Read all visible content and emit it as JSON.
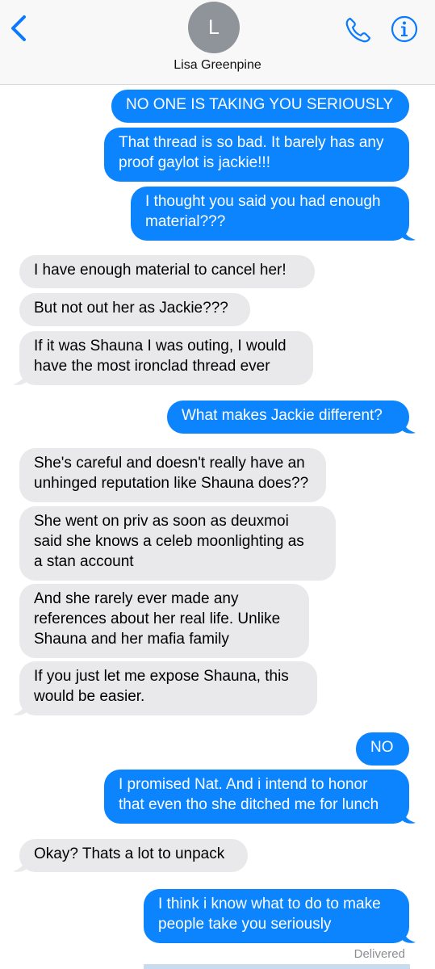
{
  "header": {
    "avatar_initial": "L",
    "contact_name": "Lisa Greenpine"
  },
  "messages": [
    {
      "direction": "sent",
      "lines": [
        "NO ONE IS TAKING YOU SERIOUSLY"
      ]
    },
    {
      "direction": "sent",
      "lines": [
        "That thread is so bad. It barely has any",
        "proof gaylot is jackie!!!"
      ]
    },
    {
      "direction": "sent",
      "lines": [
        "I thought you said you had enough",
        "material???"
      ]
    },
    {
      "direction": "received",
      "lines": [
        "I have enough material to cancel her!"
      ]
    },
    {
      "direction": "received",
      "lines": [
        "But not out her as Jackie???"
      ]
    },
    {
      "direction": "received",
      "lines": [
        "If it was Shauna I was outing, I would",
        "have the most ironclad thread ever"
      ]
    },
    {
      "direction": "sent",
      "lines": [
        "What makes Jackie different?"
      ]
    },
    {
      "direction": "received",
      "lines": [
        "She's careful and doesn't really have an",
        "unhinged reputation like Shauna does??"
      ]
    },
    {
      "direction": "received",
      "lines": [
        "She went on priv as soon as deuxmoi",
        "said she knows a celeb moonlighting as",
        "a stan account"
      ]
    },
    {
      "direction": "received",
      "lines": [
        "And she rarely ever made any",
        "references about her real life. Unlike",
        "Shauna and her mafia family"
      ]
    },
    {
      "direction": "received",
      "lines": [
        "If you just let me expose Shauna, this",
        "would be easier."
      ]
    },
    {
      "direction": "sent",
      "lines": [
        "NO"
      ]
    },
    {
      "direction": "sent",
      "lines": [
        "I promised Nat. And i intend to honor",
        "that even tho she ditched me for lunch"
      ]
    },
    {
      "direction": "received",
      "lines": [
        "Okay? Thats a lot to unpack"
      ]
    },
    {
      "direction": "sent",
      "lines": [
        "I think i know what to do to make",
        "people take you seriously"
      ]
    }
  ],
  "status": {
    "delivered_label": "Delivered"
  },
  "colors": {
    "sent_bubble": "#0b84fe",
    "received_bubble": "#e9e9eb",
    "accent": "#0a7aff"
  },
  "icons": {
    "back": "chevron-left-icon",
    "phone": "phone-icon",
    "info": "info-icon"
  }
}
